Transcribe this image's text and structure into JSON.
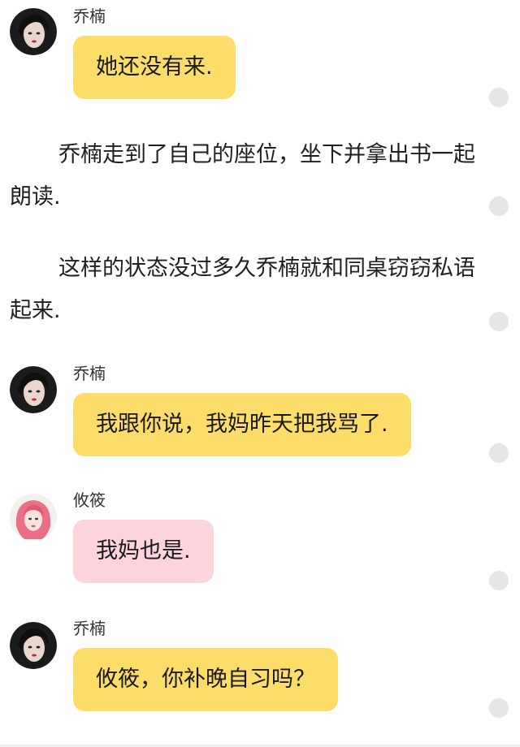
{
  "messages": [
    {
      "sender": "乔楠",
      "text": "她还没有来.",
      "color": "#fddd6a",
      "avatar": "dark-hair-girl-avatar"
    },
    {
      "sender": "乔楠",
      "text": "我跟你说，我妈昨天把我骂了.",
      "color": "#fddd6a",
      "avatar": "dark-hair-girl-avatar"
    },
    {
      "sender": "攸筱",
      "text": "我妈也是.",
      "color": "#fdd3dc",
      "avatar": "pink-hair-girl-avatar"
    },
    {
      "sender": "乔楠",
      "text": "攸筱，你补晚自习吗？",
      "color": "#fddd6a",
      "avatar": "dark-hair-girl-avatar"
    }
  ],
  "narration": [
    "乔楠走到了自己的座位，坐下并拿出书一起朗读.",
    "这样的状态没过多久乔楠就和同桌窃窃私语起来."
  ],
  "side_dots": [
    "comment-dot",
    "comment-dot",
    "comment-dot",
    "comment-dot",
    "comment-dot",
    "comment-dot"
  ]
}
